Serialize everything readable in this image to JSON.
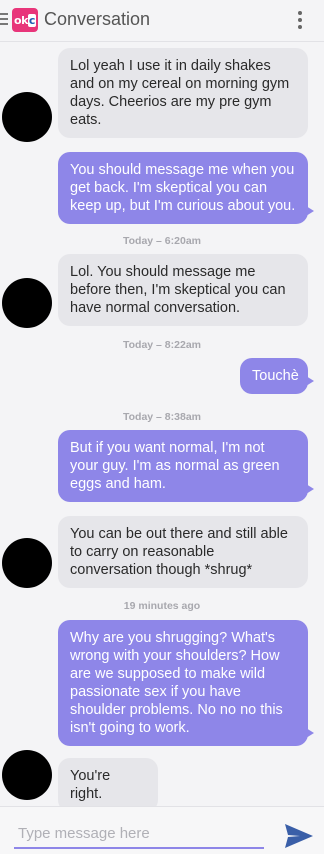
{
  "appbar": {
    "title": "Conversation",
    "logo_text_a": "ok",
    "logo_text_b": "c",
    "menu_icon": "hamburger-menu-icon",
    "overflow_icon": "more-vertical-icon"
  },
  "messages": [
    {
      "dir": "in",
      "text": "Lol yeah I use it in daily shakes and on my cereal on morning gym days. Cheerios are my pre gym eats."
    },
    {
      "dir": "out",
      "text": "You should message me when you get back. I'm skeptical you can keep up, but I'm curious about you."
    },
    {
      "dir": "stamp",
      "text": "Today – 6:20am"
    },
    {
      "dir": "in",
      "text": "Lol. You should message me before then, I'm skeptical you can have normal conversation."
    },
    {
      "dir": "stamp",
      "text": "Today – 8:22am"
    },
    {
      "dir": "out",
      "text": "Touchè"
    },
    {
      "dir": "stamp",
      "text": "Today – 8:38am"
    },
    {
      "dir": "out",
      "text": "But if you want normal, I'm not your guy. I'm as normal as green eggs and ham."
    },
    {
      "dir": "in",
      "text": "You can be out there and still able to carry on reasonable conversation though *shrug*"
    },
    {
      "dir": "stamp",
      "text": "19 minutes ago"
    },
    {
      "dir": "out",
      "text": "Why are you shrugging? What's wrong with your shoulders? How are we supposed to make wild passionate sex if you have shoulder problems. No no no this isn't going to work."
    },
    {
      "dir": "in",
      "text": "You're right."
    }
  ],
  "composer": {
    "placeholder": "Type message here",
    "value": "",
    "send_icon": "send-icon"
  },
  "colors": {
    "outgoing": "#8e86e8",
    "incoming": "#e6e6ea",
    "brand": "#e8357a"
  }
}
